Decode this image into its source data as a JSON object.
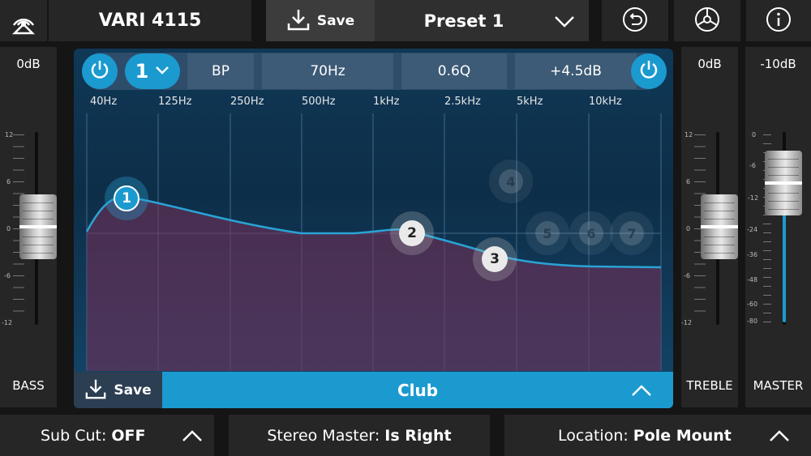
{
  "header": {
    "device_name": "VARI 4115",
    "save_label": "Save",
    "preset_name": "Preset 1"
  },
  "band_bar": {
    "band_number": "1",
    "filter_type": "BP",
    "frequency": "70Hz",
    "q": "0.6Q",
    "gain": "+4.5dB"
  },
  "eq": {
    "freq_labels": [
      "40Hz",
      "125Hz",
      "250Hz",
      "500Hz",
      "1kHz",
      "2.5kHz",
      "5kHz",
      "10kHz"
    ],
    "nodes": [
      {
        "label": "1",
        "active": true
      },
      {
        "label": "2",
        "active": false
      },
      {
        "label": "3",
        "active": false
      },
      {
        "label": "4",
        "active": false,
        "dimmed": true
      },
      {
        "label": "5",
        "active": false,
        "dimmed": true
      },
      {
        "label": "6",
        "active": false,
        "dimmed": true
      },
      {
        "label": "7",
        "active": false,
        "dimmed": true
      }
    ],
    "curve_color": "#2aa3d4",
    "fill_color": "#7a2e55"
  },
  "eq_footer": {
    "save_label": "Save",
    "preset_name": "Club"
  },
  "bass": {
    "level": "0dB",
    "name": "BASS",
    "ticks": [
      "12",
      "6",
      "0",
      "-6",
      "-12"
    ]
  },
  "treble": {
    "level": "0dB",
    "name": "TREBLE",
    "ticks": [
      "12",
      "6",
      "0",
      "-6",
      "-12"
    ]
  },
  "master": {
    "level": "-10dB",
    "name": "MASTER",
    "ticks": [
      "0",
      "-6",
      "-12",
      "-24",
      "-36",
      "-48",
      "-60",
      "-80"
    ]
  },
  "footer": {
    "sub_cut": {
      "label": "Sub Cut:",
      "value": "OFF"
    },
    "stereo": {
      "label": "Stereo Master:",
      "value": "Is Right"
    },
    "location": {
      "label": "Location:",
      "value": "Pole Mount"
    }
  },
  "colors": {
    "accent": "#1b9ad0",
    "panel": "#262626",
    "background": "#151515"
  }
}
